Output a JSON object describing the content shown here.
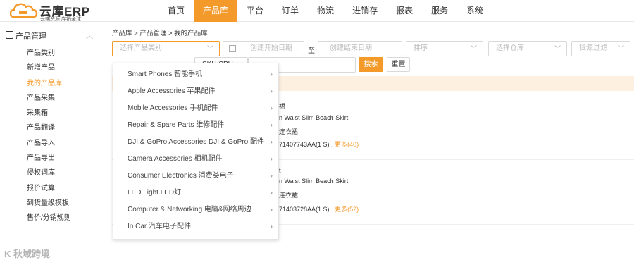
{
  "logo": {
    "title": "云库ERP",
    "subtitle": "云端资源 库销全球"
  },
  "nav": [
    "首页",
    "产品库",
    "平台",
    "订单",
    "物流",
    "进销存",
    "报表",
    "服务",
    "系统"
  ],
  "nav_active": "产品库",
  "sidebar": {
    "section": "产品管理",
    "items": [
      "产品类别",
      "新增产品",
      "我的产品库",
      "产品采集",
      "采集箱",
      "产品翻译",
      "产品导入",
      "产品导出",
      "侵权词库",
      "报价试算",
      "到货量级模板",
      "售价/分销规则"
    ],
    "active": "我的产品库"
  },
  "watermark": "K 秋域跨境",
  "breadcrumb": "产品库 > 产品管理 > 我的产品库",
  "filters": {
    "category_placeholder": "选择产品类别",
    "start_date_placeholder": "创建开始日期",
    "date_separator": "至",
    "end_date_placeholder": "创建结束日期",
    "sort_placeholder": "排序",
    "warehouse_placeholder": "选择仓库",
    "stock_filter_placeholder": "货源过滤",
    "second_select_value": "SKU/SPU"
  },
  "buttons": {
    "search": "搜索",
    "reset": "重置"
  },
  "rows": [
    {
      "title_tail": "裙",
      "name_en": "n Waist Slim Beach Skirt",
      "name_cn": "连衣裙",
      "sku": "71407743AA(1 S) ,",
      "more": "更多(40)"
    },
    {
      "title_tail": "t",
      "name_en": "n Waist Slim Beach Skirt",
      "name_cn": "连衣裙",
      "sku": "71403728AA(1 S) ,",
      "more": "更多(52)"
    }
  ],
  "dropdown": [
    "Smart Phones 智能手机",
    "Apple Accessories 苹果配件",
    "Mobile Accessories 手机配件",
    "Repair & Spare Parts 维修配件",
    "DJI & GoPro Accessories DJI & GoPro 配件",
    "Camera Accessories 相机配件",
    "Consumer Electronics 消费类电子",
    "LED Light LED灯",
    "Computer & Networking 电脑&网络周边",
    "In Car 汽车电子配件"
  ],
  "colors": {
    "accent": "#f39a2b",
    "header_row": "#fdf0e1"
  }
}
